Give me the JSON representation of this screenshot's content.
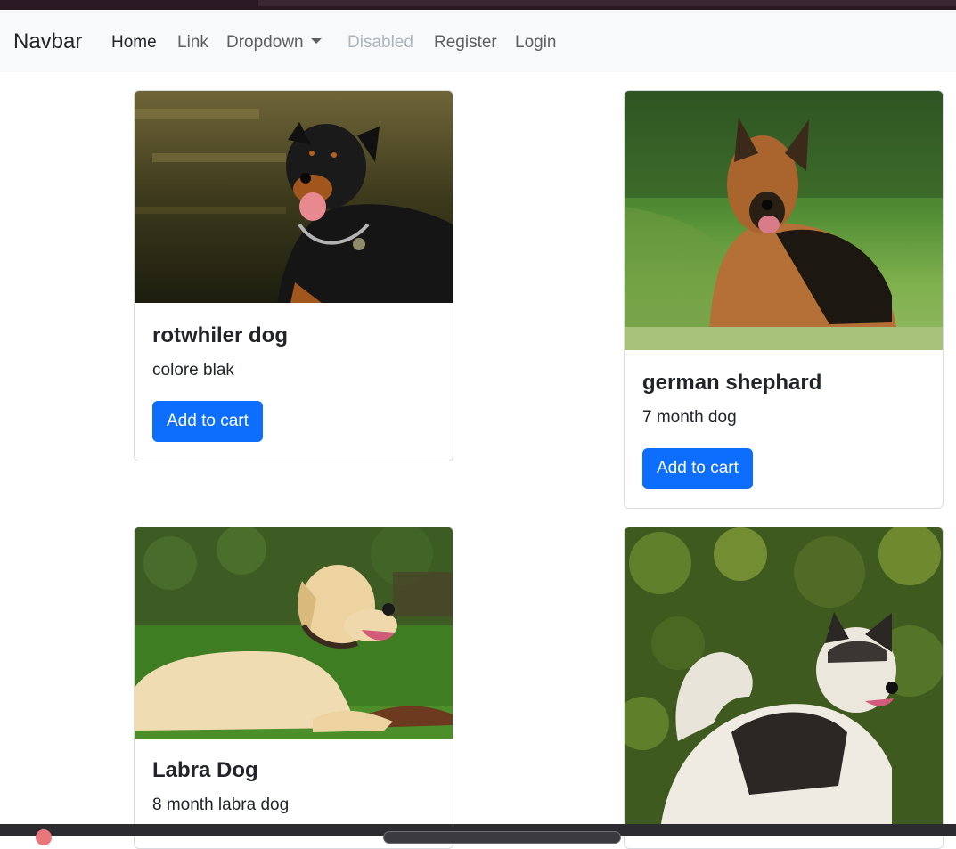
{
  "navbar": {
    "brand": "Navbar",
    "links": [
      {
        "label": "Home"
      },
      {
        "label": "Link"
      },
      {
        "label": "Dropdown"
      },
      {
        "label": "Disabled"
      },
      {
        "label": "Register"
      },
      {
        "label": "Login"
      }
    ]
  },
  "cards": [
    {
      "title": "rotwhiler dog",
      "text": "colore blak",
      "button": "Add to cart"
    },
    {
      "title": "german shephard",
      "text": "7 month dog",
      "button": "Add to cart"
    },
    {
      "title": "Labra Dog",
      "text": "8 month labra dog"
    },
    {}
  ],
  "colors": {
    "primary": "#0d6efd",
    "navbar_bg": "#f8f9fa",
    "nav_link": "#5c5f63",
    "nav_disabled": "#adb5bd"
  }
}
